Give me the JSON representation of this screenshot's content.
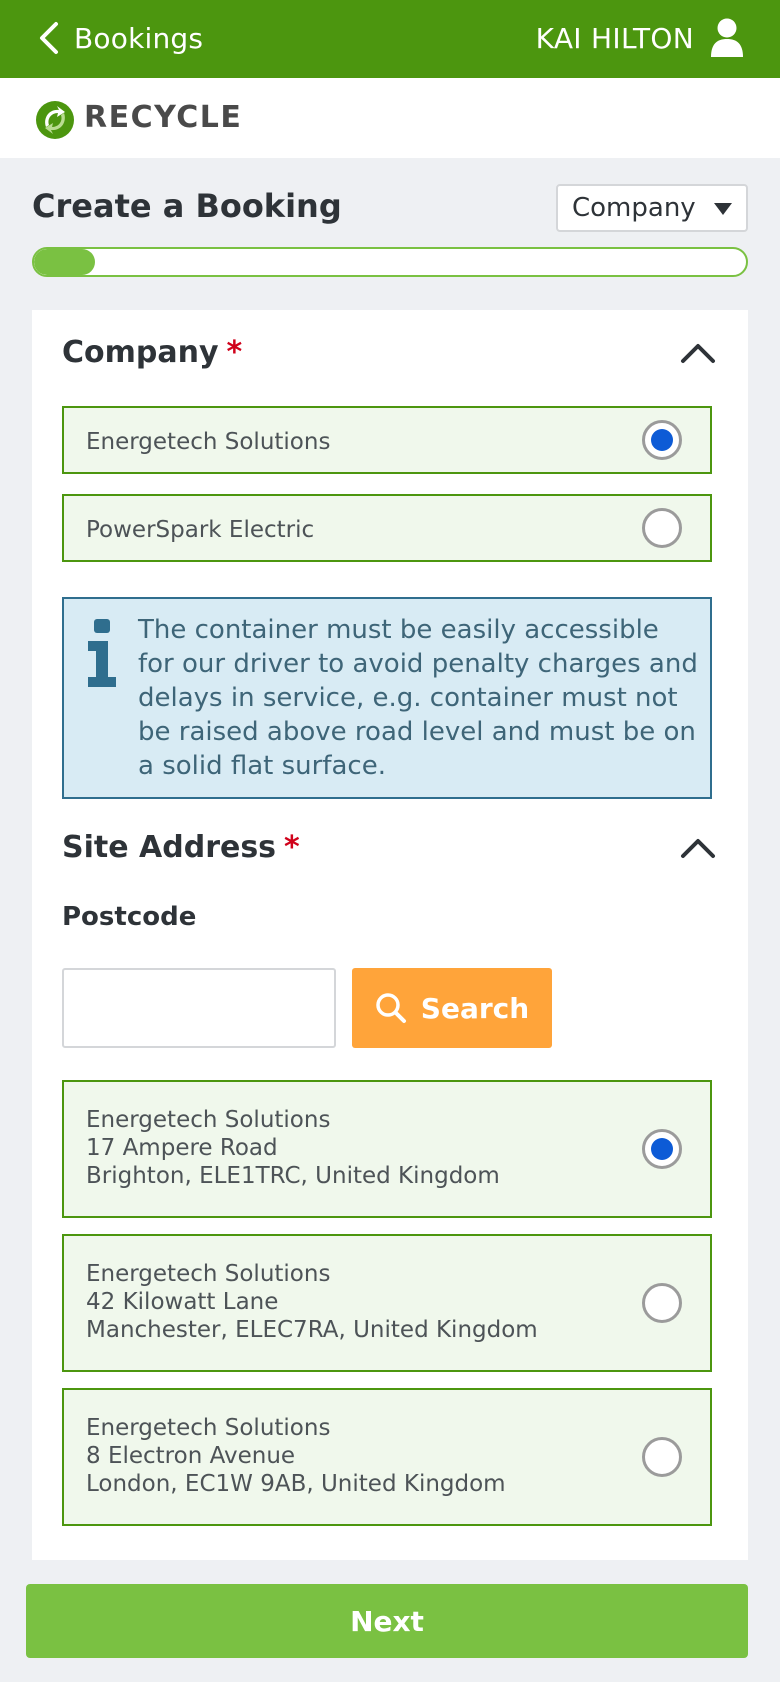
{
  "header": {
    "back_label": "Bookings",
    "user_name": "KAI HILTON"
  },
  "brand": {
    "name": "RECYCLE"
  },
  "page": {
    "title": "Create a Booking",
    "type_select_value": "Company",
    "progress_fraction": 0.085
  },
  "company_section": {
    "title": "Company",
    "required_mark": "*",
    "options": [
      {
        "label": "Energetech Solutions",
        "selected": true
      },
      {
        "label": "PowerSpark Electric",
        "selected": false
      }
    ]
  },
  "info_notice": {
    "text": "The container must be easily accessible for our driver to avoid penalty charges and delays in service, e.g. container must not be raised above road level and must be on a solid flat surface."
  },
  "site_address_section": {
    "title": "Site Address",
    "required_mark": "*",
    "postcode_label": "Postcode",
    "postcode_value": "",
    "search_label": "Search",
    "addresses": [
      {
        "line1": "Energetech Solutions",
        "line2": "17 Ampere Road",
        "line3": "Brighton, ELE1TRC, United Kingdom",
        "selected": true
      },
      {
        "line1": "Energetech Solutions",
        "line2": "42 Kilowatt Lane",
        "line3": "Manchester, ELEC7RA, United Kingdom",
        "selected": false
      },
      {
        "line1": "Energetech Solutions",
        "line2": "8 Electron Avenue",
        "line3": "London, EC1W 9AB, United Kingdom",
        "selected": false
      }
    ]
  },
  "footer": {
    "next_label": "Next"
  },
  "colors": {
    "primary_green": "#4c960f",
    "light_green": "#7ac142",
    "selected_bg": "#f0f8ec",
    "radio_selected": "#0d5bd6",
    "search_orange": "#ffa43a",
    "required_red": "#d0021b",
    "info_bg": "#d8ebf4",
    "info_border": "#2f6e8e"
  },
  "icons": {
    "back": "chevron-left-icon",
    "user": "user-icon",
    "logo": "recycle-logo-icon",
    "collapse": "chevron-up-icon",
    "info": "info-icon",
    "search": "search-icon",
    "dropdown": "caret-down-icon"
  }
}
